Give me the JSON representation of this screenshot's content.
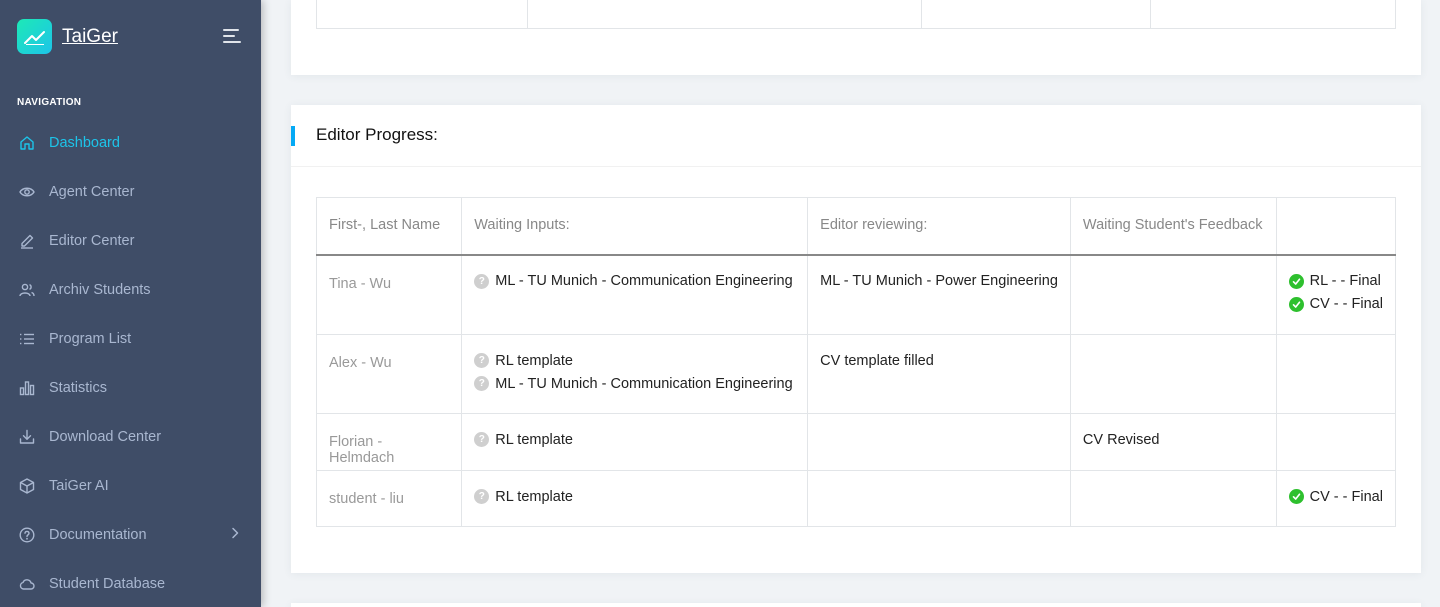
{
  "brand": {
    "name": "TaiGer"
  },
  "nav": {
    "caption": "NAVIGATION",
    "items": [
      {
        "label": "Dashboard",
        "icon": "home-icon",
        "active": true
      },
      {
        "label": "Agent Center",
        "icon": "eye-icon"
      },
      {
        "label": "Editor Center",
        "icon": "pencil-icon"
      },
      {
        "label": "Archiv Students",
        "icon": "users-icon"
      },
      {
        "label": "Program List",
        "icon": "list-icon"
      },
      {
        "label": "Statistics",
        "icon": "bar-chart-icon"
      },
      {
        "label": "Download Center",
        "icon": "download-icon"
      },
      {
        "label": "TaiGer AI",
        "icon": "box-icon"
      },
      {
        "label": "Documentation",
        "icon": "help-circle-icon",
        "has_submenu": true
      },
      {
        "label": "Student Database",
        "icon": "cloud-icon"
      }
    ]
  },
  "editor_progress": {
    "title": "Editor Progress:",
    "headers": [
      "First-, Last Name",
      "Waiting Inputs:",
      "Editor reviewing:",
      "Waiting Student's Feedback",
      ""
    ],
    "rows": [
      {
        "name": "Tina - Wu",
        "waiting_inputs": [
          "ML - TU Munich - Communication Engineering"
        ],
        "editor_reviewing": [
          "ML - TU Munich - Power Engineering"
        ],
        "waiting_feedback": [],
        "final": [
          "RL - - Final",
          "CV - - Final"
        ]
      },
      {
        "name": "Alex - Wu",
        "waiting_inputs": [
          "RL template",
          "ML - TU Munich - Communication Engineering"
        ],
        "editor_reviewing": [
          "CV template filled"
        ],
        "waiting_feedback": [],
        "final": []
      },
      {
        "name": "Florian - Helmdach",
        "waiting_inputs": [
          "RL template"
        ],
        "editor_reviewing": [],
        "waiting_feedback": [
          "CV Revised"
        ],
        "final": []
      },
      {
        "name": "student - liu",
        "waiting_inputs": [
          "RL template"
        ],
        "editor_reviewing": [],
        "waiting_feedback": [],
        "final": [
          "CV - - Final"
        ]
      }
    ]
  },
  "colors": {
    "sidebar": "#3f4d67",
    "active": "#1dc4e9",
    "accent_bar": "#04a9f5",
    "check": "#2ec02e"
  }
}
